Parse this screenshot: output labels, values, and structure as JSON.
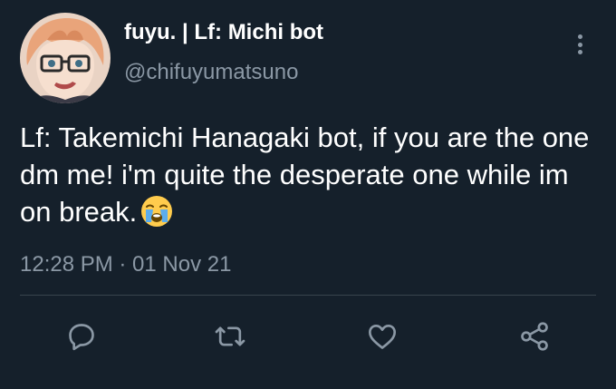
{
  "tweet": {
    "display_name": "fuyu. | Lf: Michi bot",
    "handle": "@chifuyumatsuno",
    "text": "Lf: Takemichi Hanagaki bot, if you are the one dm me! i'm quite the desperate one while im on break.",
    "emoji": "crying-face-emoji",
    "timestamp": "12:28 PM · 01 Nov 21"
  },
  "icons": {
    "more": "more-vertical-icon",
    "reply": "reply-icon",
    "retweet": "retweet-icon",
    "like": "heart-icon",
    "share": "share-icon"
  },
  "colors": {
    "background": "#15202b",
    "primary_text": "#ffffff",
    "secondary_text": "#8b98a5",
    "divider": "#38444d",
    "icon": "#8b98a5"
  }
}
